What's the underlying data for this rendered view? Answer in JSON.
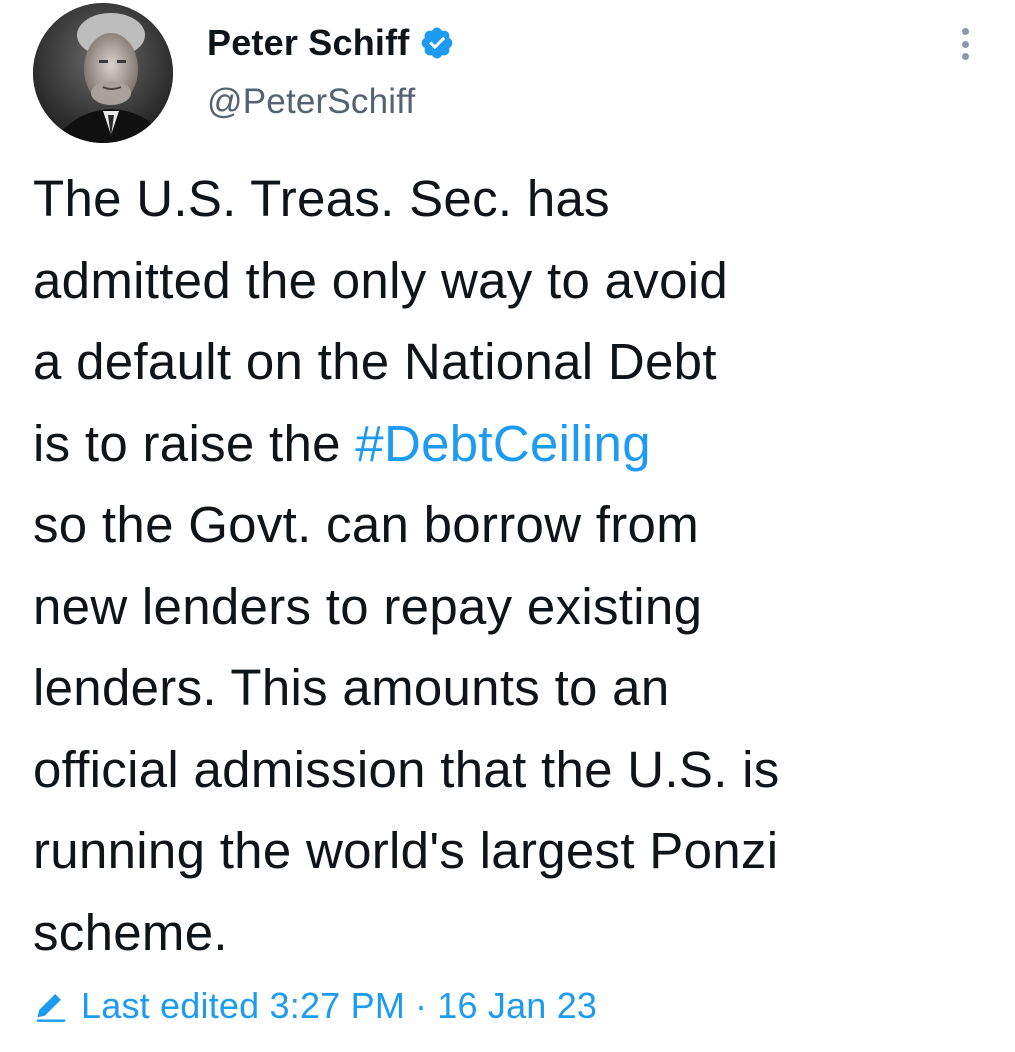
{
  "author": {
    "display_name": "Peter Schiff",
    "handle": "@PeterSchiff",
    "verified_icon": "verified-badge-icon",
    "avatar": "profile-photo"
  },
  "tweet": {
    "lines": [
      {
        "text": "The U.S. Treas. Sec. has"
      },
      {
        "text": "admitted the only way to avoid"
      },
      {
        "text": "a default on the National Debt"
      },
      {
        "prefix": "is to raise the ",
        "hashtag": "#DebtCeiling"
      },
      {
        "text": "so the Govt. can borrow from"
      },
      {
        "text": "new lenders to repay existing"
      },
      {
        "text": "lenders. This amounts to an"
      },
      {
        "text": "official admission that the U.S. is"
      },
      {
        "text": "running the world's largest Ponzi"
      },
      {
        "text": "scheme."
      }
    ]
  },
  "edit_info": {
    "icon": "pencil-icon",
    "label": "Last edited 3:27 PM",
    "separator": "·",
    "date": "16 Jan 23"
  },
  "menu": {
    "icon": "more-options-icon"
  },
  "colors": {
    "text": "#0f1419",
    "secondary": "#536471",
    "accent": "#1d9bf0"
  }
}
